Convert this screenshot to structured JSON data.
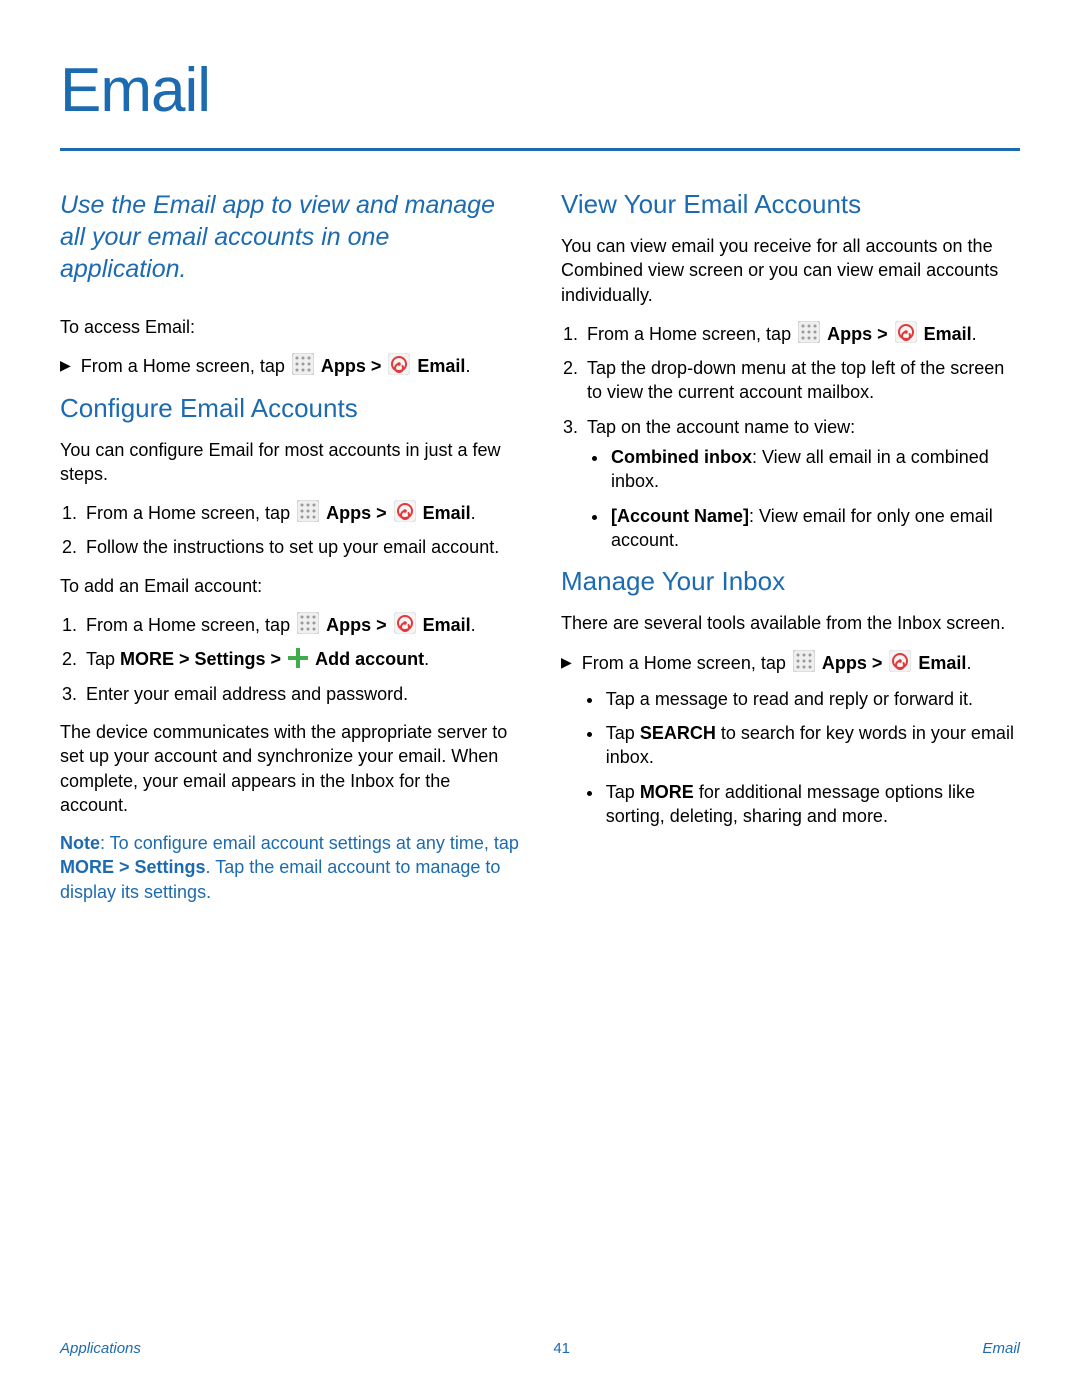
{
  "title": "Email",
  "intro": "Use the Email app to view and manage all your email accounts in one application.",
  "access_lead": "To access Email:",
  "nav": {
    "from_home_prefix": "From a Home screen, tap ",
    "apps_label": "Apps",
    "sep": " > ",
    "email_label": "Email",
    "period": "."
  },
  "configure": {
    "heading": "Configure Email Accounts",
    "lead": "You can configure Email for most accounts in just a few steps.",
    "step2": "Follow the instructions to set up your email account.",
    "add_lead": "To add an Email account:",
    "step_add_2a": "Tap ",
    "step_add_2b": "MORE > Settings > ",
    "step_add_2c": "Add account",
    "step_add_3": "Enter your email address and password.",
    "post": "The device communicates with the appropriate server to set up your account and synchronize your email. When complete, your email appears in the Inbox for the account.",
    "note_label": "Note",
    "note_a": ": To configure email account settings at any time, tap ",
    "note_b": "MORE > Settings",
    "note_c": ". Tap the email account to manage to display its settings."
  },
  "view": {
    "heading": "View Your Email Accounts",
    "lead": "You can view email you receive for all accounts on the Combined view screen or you can view email accounts individually.",
    "step2": "Tap the drop-down menu at the top left of the screen to view the current account mailbox.",
    "step3": "Tap on the account name to view:",
    "b1_label": "Combined inbox",
    "b1_rest": ": View all email in a combined inbox.",
    "b2_label": "[Account Name]",
    "b2_rest": ": View email for only one email account."
  },
  "manage": {
    "heading": "Manage Your Inbox",
    "lead": "There are several tools available from the Inbox screen.",
    "b1": "Tap a message to read and reply or forward it.",
    "b2a": "Tap ",
    "b2b": "SEARCH",
    "b2c": " to search for key words in your email inbox.",
    "b3a": "Tap ",
    "b3b": "MORE",
    "b3c": " for additional message options like sorting, deleting, sharing and more."
  },
  "footer": {
    "left": "Applications",
    "center": "41",
    "right": "Email"
  }
}
